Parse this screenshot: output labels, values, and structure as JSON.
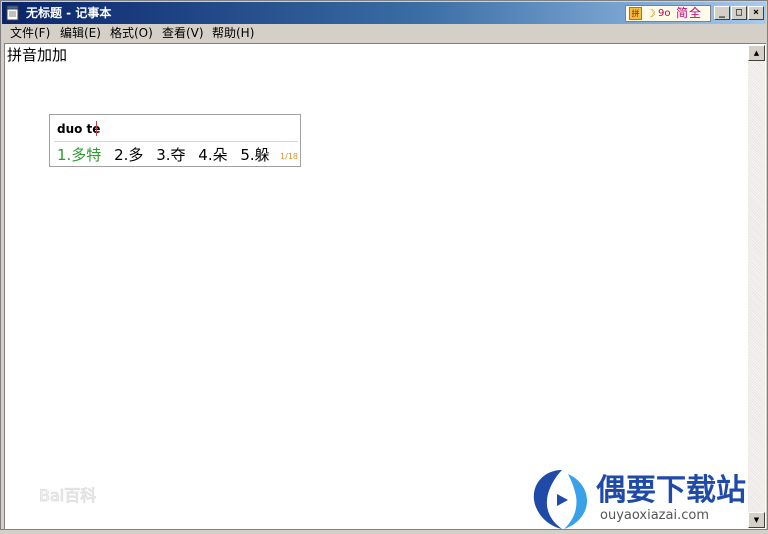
{
  "window": {
    "title": "无标题 - 记事本"
  },
  "ime_status": {
    "logo_icon": "sogou-logo-icon",
    "moon_glyph": "☽",
    "punct_glyph": "9o",
    "mode_label": "简全"
  },
  "title_buttons": {
    "minimize": "_",
    "maximize": "□",
    "close": "×"
  },
  "menu": {
    "items": [
      {
        "label": "文件(F)"
      },
      {
        "label": "编辑(E)"
      },
      {
        "label": "格式(O)"
      },
      {
        "label": "查看(V)"
      },
      {
        "label": "帮助(H)"
      }
    ]
  },
  "editor": {
    "text": "拼音加加"
  },
  "candidate_window": {
    "input": "duo te",
    "candidates": [
      {
        "label": "1.多特"
      },
      {
        "label": "2.多"
      },
      {
        "label": "3.夺"
      },
      {
        "label": "4.朵"
      },
      {
        "label": "5.躲"
      }
    ],
    "page": "1/18",
    "selected_color": "#2e9a2e"
  },
  "scrollbar": {
    "up_glyph": "▲",
    "down_glyph": "▼"
  },
  "watermarks": {
    "baidu": "Bai百科",
    "site_name": "偶要下载站",
    "site_url": "ouyaoxiazai.com"
  },
  "colors": {
    "titlebar_start": "#0a246a",
    "titlebar_end": "#a6caf0",
    "site_brand": "#1f4aa8"
  }
}
